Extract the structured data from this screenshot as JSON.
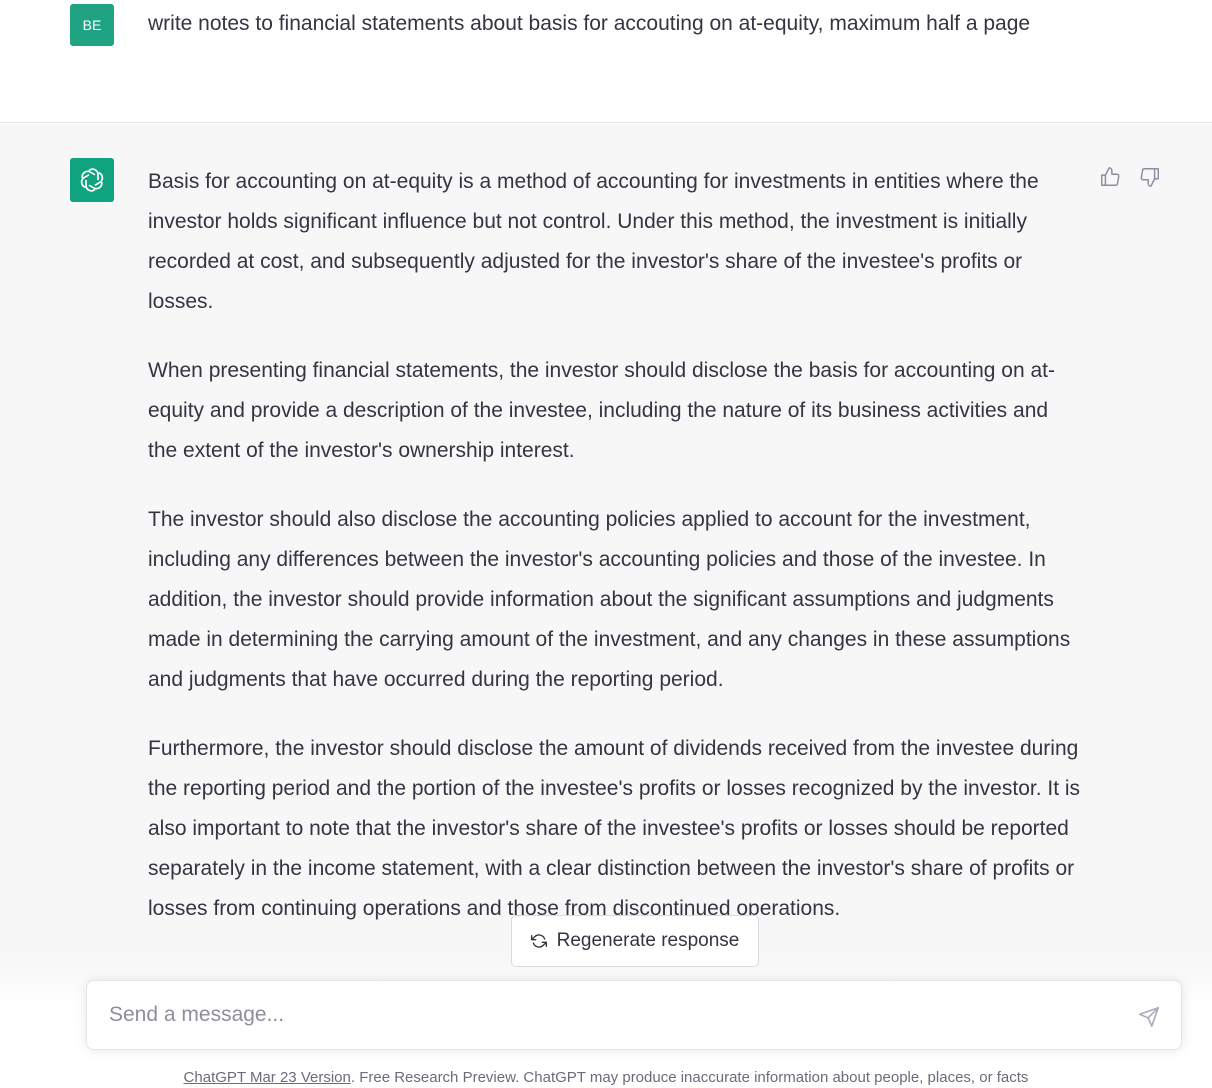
{
  "user_message": {
    "avatar_initials": "BE",
    "avatar_color": "#1fa383",
    "text": "write notes to financial statements about basis for accouting on at-equity, maximum half a page"
  },
  "assistant_message": {
    "avatar_icon": "openai-logo-icon",
    "avatar_color": "#10a37f",
    "paragraphs": [
      "Basis for accounting on at-equity is a method of accounting for investments in entities where the investor holds significant influence but not control. Under this method, the investment is initially recorded at cost, and subsequently adjusted for the investor's share of the investee's profits or losses.",
      "When presenting financial statements, the investor should disclose the basis for accounting on at-equity and provide a description of the investee, including the nature of its business activities and the extent of the investor's ownership interest.",
      "The investor should also disclose the accounting policies applied to account for the investment, including any differences between the investor's accounting policies and those of the investee. In addition, the investor should provide information about the significant assumptions and judgments made in determining the carrying amount of the investment, and any changes in these assumptions and judgments that have occurred during the reporting period.",
      "Furthermore, the investor should disclose the amount of dividends received from the investee during the reporting period and the portion of the investee's profits or losses recognized by the investor. It is also important to note that the investor's share of the investee's profits or losses should be reported separately in the income statement, with a clear distinction between the investor's share of profits or losses from continuing operations and those from discontinued operations."
    ],
    "feedback_icons": [
      "thumbs-up-icon",
      "thumbs-down-icon"
    ]
  },
  "regenerate": {
    "label": "Regenerate response",
    "icon": "refresh-icon"
  },
  "composer": {
    "placeholder": "Send a message...",
    "send_icon": "send-icon"
  },
  "footer": {
    "version_link": "ChatGPT Mar 23 Version",
    "disclaimer": ". Free Research Preview. ChatGPT may produce inaccurate information about people, places, or facts"
  }
}
